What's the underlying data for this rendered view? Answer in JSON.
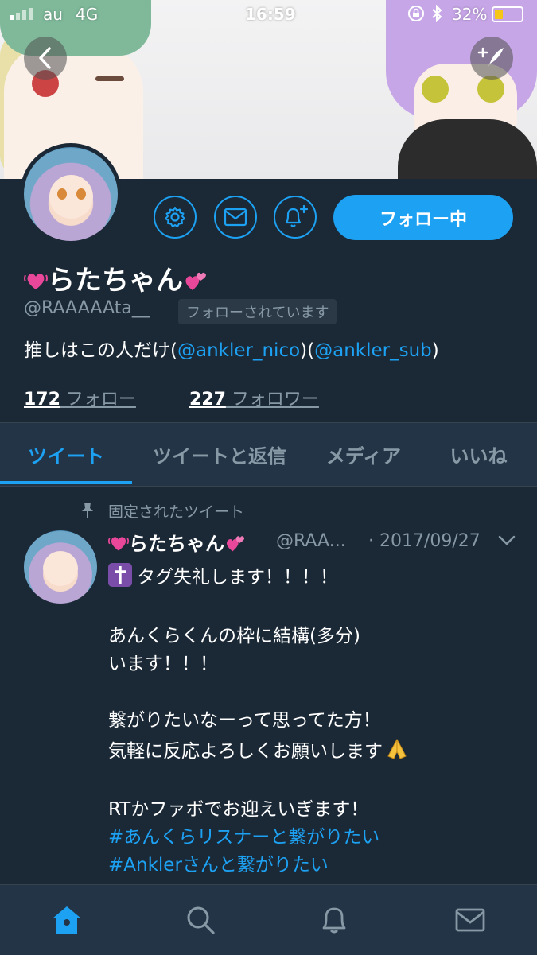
{
  "status_bar": {
    "carrier": "au",
    "network": "4G",
    "time": "16:59",
    "battery": "32%",
    "battery_level": 0.32
  },
  "header": {
    "back_icon": "chevron-left-icon",
    "compose_icon": "compose-tweet-icon"
  },
  "profile": {
    "display_name": "らたちゃん",
    "handle": "@RAAAAAta__",
    "follows_you_badge": "フォローされています",
    "bio_prefix": "推しはこの人だけ(",
    "bio_mention1": "@ankler_nico",
    "bio_mid": ")(",
    "bio_mention2": "@ankler_sub",
    "bio_suffix": ")",
    "following_count": "172",
    "following_label": " フォロー",
    "followers_count": "227",
    "followers_label": " フォロワー",
    "follow_button_label": "フォロー中",
    "accent_color": "#1da1f2"
  },
  "tabs": [
    {
      "label": "ツイート",
      "active": true
    },
    {
      "label": "ツイートと返信",
      "active": false
    },
    {
      "label": "メディア",
      "active": false
    },
    {
      "label": "いいね",
      "active": false
    }
  ],
  "pinned_tweet": {
    "pinned_label": "固定されたツイート",
    "author_name": "らたちゃん",
    "author_handle": "@RAA...",
    "date": "· 2017/09/27",
    "lines": [
      "タグ失礼します！！！！",
      "",
      "あんくらくんの枠に結構(多分)",
      "います！！！",
      "",
      "繋がりたいなーって思ってた方！",
      "気軽に反応よろしくお願いします",
      "",
      "RTかファボでお迎えいぎます！"
    ],
    "hashtags": [
      "#あんくらリスナーと繋がりたい",
      "#Anklerさんと繋がりたい"
    ]
  },
  "bottom_nav": [
    {
      "name": "home-icon"
    },
    {
      "name": "search-icon"
    },
    {
      "name": "notifications-bell-icon"
    },
    {
      "name": "messages-envelope-icon"
    }
  ]
}
